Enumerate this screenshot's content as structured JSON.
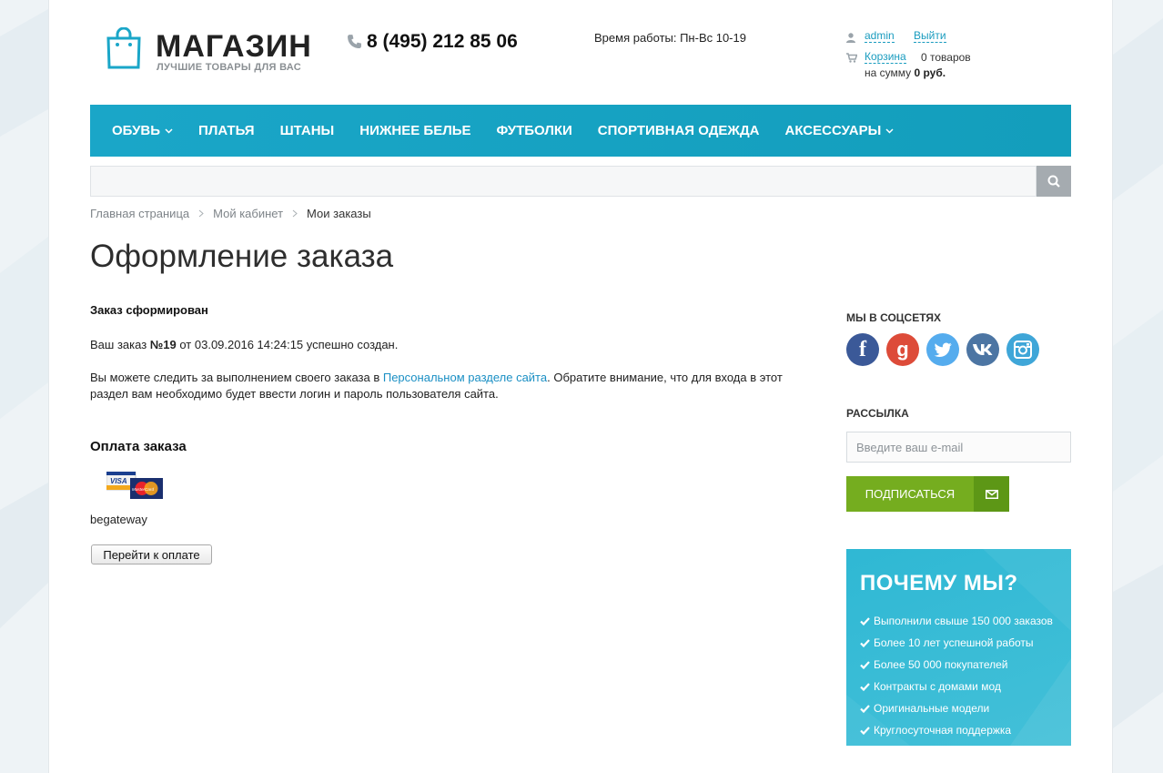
{
  "header": {
    "logo_title": "МАГАЗИН",
    "logo_subtitle": "ЛУЧШИЕ ТОВАРЫ ДЛЯ ВАС",
    "phone": "8 (495) 212 85 06",
    "hours": "Время работы: Пн-Вс 10-19",
    "user": "admin",
    "logout": "Выйти",
    "cart_label": "Корзина",
    "cart_count": "0 товаров",
    "cart_sum_prefix": "на сумму",
    "cart_sum_value": "0 руб."
  },
  "nav": [
    {
      "label": "ОБУВЬ"
    },
    {
      "label": "ПЛАТЬЯ"
    },
    {
      "label": "ШТАНЫ"
    },
    {
      "label": "НИЖНЕЕ БЕЛЬЕ"
    },
    {
      "label": "ФУТБОЛКИ"
    },
    {
      "label": "СПОРТИВНАЯ ОДЕЖДА"
    },
    {
      "label": "АКСЕССУАРЫ"
    }
  ],
  "search": {
    "value": ""
  },
  "breadcrumb": [
    "Главная страница",
    "Мой кабинет",
    "Мои заказы"
  ],
  "page_title": "Оформление заказа",
  "order": {
    "status_title": "Заказ сформирован",
    "line_prefix": "Ваш заказ",
    "number": "№19",
    "line_suffix": "от 03.09.2016 14:24:15 успешно создан.",
    "track_prefix": "Вы можете следить за выполнением своего заказа в",
    "track_link": "Персональном разделе сайта",
    "track_suffix": ". Обратите внимание, что для входа в этот раздел вам необходимо будет ввести логин и пароль пользователя сайта."
  },
  "payment": {
    "title": "Оплата заказа",
    "card_visa": "VISA",
    "card_mc": "MasterCard",
    "system": "begateway",
    "button": "Перейти к оплате"
  },
  "sidebar": {
    "social_title": "МЫ В СОЦСЕТЯХ",
    "social": [
      "facebook-icon",
      "google-plus-icon",
      "twitter-icon",
      "vk-icon",
      "instagram-icon"
    ],
    "newsletter_title": "РАССЫЛКА",
    "email_placeholder": "Введите ваш e-mail",
    "subscribe": "ПОДПИСАТЬСЯ",
    "why_title": "ПОЧЕМУ МЫ?",
    "why_items": [
      "Выполнили свыше 150 000 заказов",
      "Более 10 лет успешной работы",
      "Более 50 000 покупателей",
      "Контракты с домами мод",
      "Оригинальные модели",
      "Круглосуточная поддержка"
    ]
  },
  "colors": {
    "accent": "#1aa6c8",
    "link": "#1a8fc4",
    "subscribe_green": "#75ad1f",
    "search_button": "#a5abb0"
  }
}
